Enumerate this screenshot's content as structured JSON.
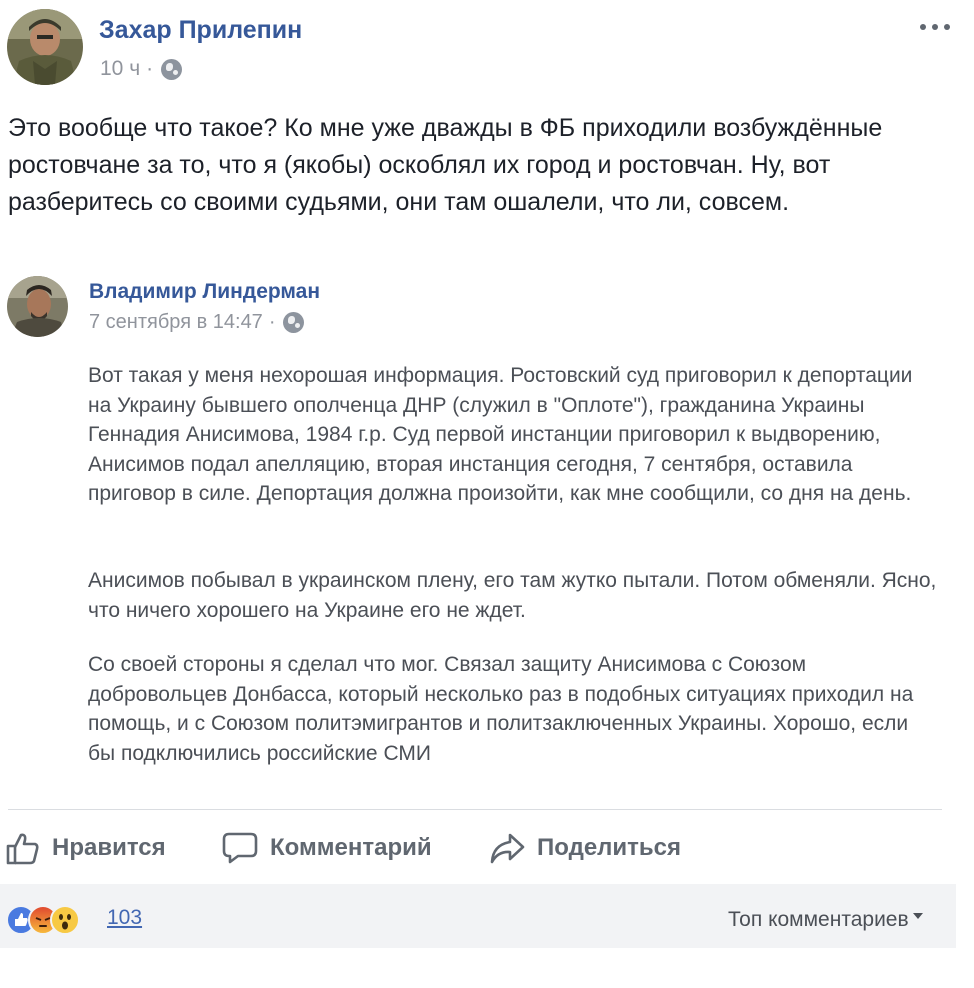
{
  "post": {
    "author": "Захар Прилепин",
    "time": "10 ч",
    "separator": "·",
    "privacy_icon": "globe-icon",
    "text": "Это вообще что такое? Ко мне уже дважды в ФБ приходили возбуждённые ростовчане за то, что я (якобы) оскоблял их город и ростовчан. Ну, вот разберитесь со своими судьями, они там ошалели, что ли, совсем."
  },
  "shared": {
    "author": "Владимир Линдерман",
    "time": "7 сентября в 14:47",
    "separator": "·",
    "privacy_icon": "globe-icon",
    "paragraphs": [
      "Вот такая у меня нехорошая информация. Ростовский суд приговорил к депортации на Украину бывшего ополченца ДНР (служил в \"Оплоте\"), гражданина Украины Геннадия Анисимова, 1984 г.р. Суд первой инстанции приговорил к выдворению, Анисимов подал апелляцию, вторая инстанция сегодня, 7 сентября, оставила приговор в силе. Депортация должна произойти, как мне сообщили, со дня на день.",
      "Анисимов побывал в украинском плену, его там жутко пытали. Потом обменяли. Ясно, что ничего хорошего на Украине его не ждет.",
      "Со своей стороны я сделал что мог. Связал защиту Анисимова с Союзом добровольцев Донбасса, который несколько раз в подобных ситуациях приходил на помощь, и с Союзом политэмигрантов и политзаключенных Украины. Хорошо, если бы подключились российские СМИ"
    ]
  },
  "actions": {
    "like": "Нравится",
    "comment": "Комментарий",
    "share": "Поделиться"
  },
  "reactions": {
    "icons": [
      "like-reaction-icon",
      "angry-reaction-icon",
      "wow-reaction-icon"
    ],
    "count": "103"
  },
  "comments_sort": {
    "label": "Топ комментариев"
  },
  "colors": {
    "link": "#365899",
    "meta": "#90949c",
    "like_blue": "#4267b2",
    "footer_bg": "#f2f3f5"
  }
}
